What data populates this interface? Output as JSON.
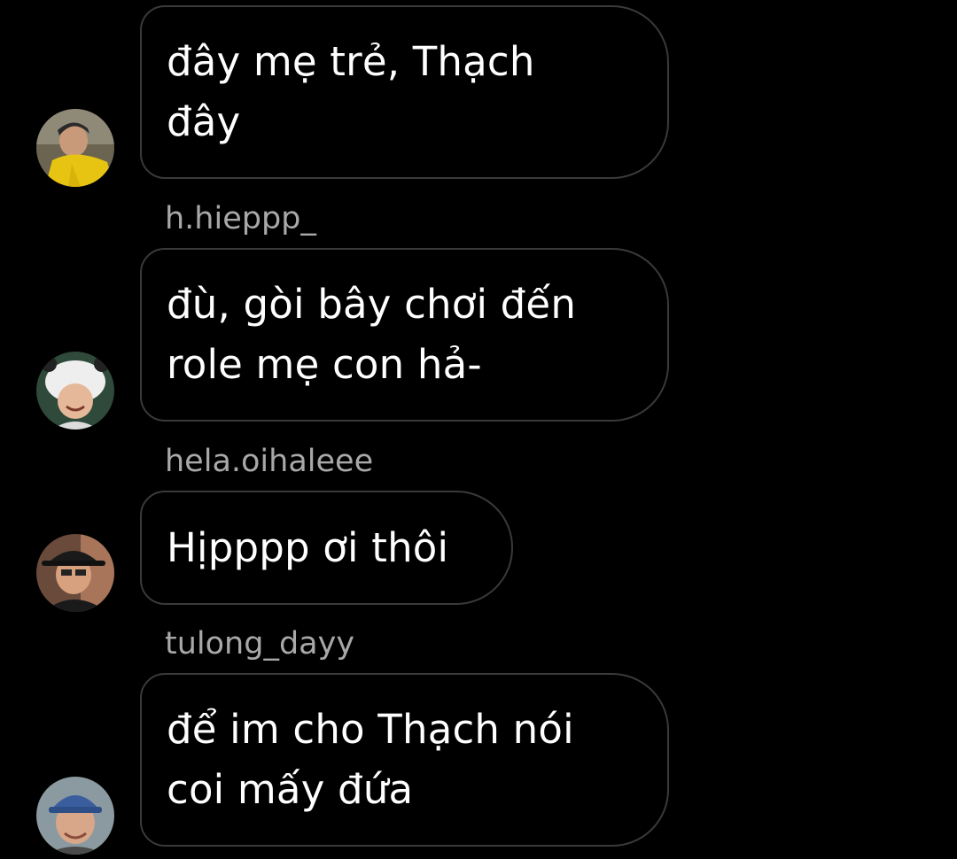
{
  "colors": {
    "background": "#000000",
    "bubble_border": "#3a3a3a",
    "message_text": "#ffffff",
    "username_text": "#a8a8a8"
  },
  "messages": [
    {
      "username": "",
      "text": "đây mẹ trẻ, Thạch\nđây",
      "avatar": "avatar-yellow-jacket"
    },
    {
      "username": "h.hieppp_",
      "text": "đù, gòi bây chơi đến\nrole mẹ con hả-",
      "avatar": "avatar-panda-hat"
    },
    {
      "username": "hela.oihaleee",
      "text": "Hịpppp ơi thôi",
      "avatar": "avatar-black-hat"
    },
    {
      "username": "tulong_dayy",
      "text": "để im cho Thạch nói\ncoi mấy đứa",
      "avatar": "avatar-blue-cap"
    }
  ]
}
